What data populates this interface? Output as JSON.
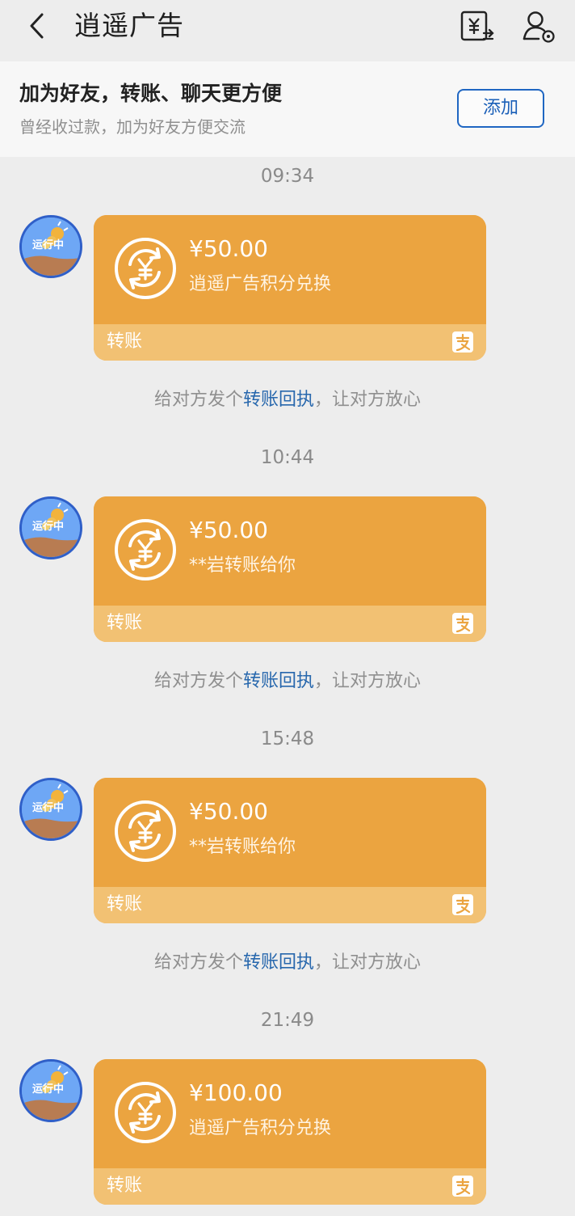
{
  "header": {
    "title": "逍遥广告",
    "back_icon": "back-arrow-icon",
    "bill_icon": "yuan-bill-icon",
    "profile_icon": "user-settings-icon"
  },
  "banner": {
    "title": "加为好友，转账、聊天更方便",
    "subtitle": "曾经收过款，加为好友方便交流",
    "button": "添加"
  },
  "avatar_label": "运行中",
  "messages": [
    {
      "time": "09:34",
      "amount": "¥50.00",
      "desc": "逍遥广告积分兑换",
      "label": "转账"
    },
    {
      "time": "10:44",
      "amount": "¥50.00",
      "desc": "**岩转账给你",
      "label": "转账"
    },
    {
      "time": "15:48",
      "amount": "¥50.00",
      "desc": "**岩转账给你",
      "label": "转账"
    },
    {
      "time": "21:49",
      "amount": "¥100.00",
      "desc": "逍遥广告积分兑换",
      "label": "转账"
    }
  ],
  "receipt": {
    "prefix": "给对方发个",
    "link": "转账回执",
    "suffix": "，让对方放心"
  },
  "colors": {
    "card": "#eba440",
    "card_bottom": "#f2c173",
    "link": "#2767ad",
    "button_border": "#1f66c2"
  }
}
